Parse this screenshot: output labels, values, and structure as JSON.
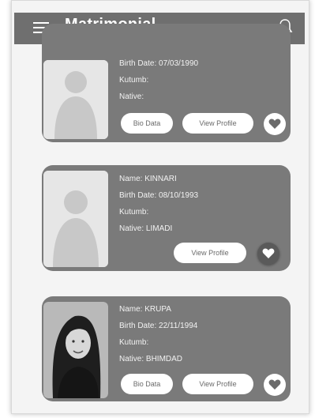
{
  "appbar": {
    "title": "Matrimonial"
  },
  "labels": {
    "name": "Name:",
    "birth_date": "Birth Date:",
    "kutumb": "Kutumb:",
    "native": "Native:"
  },
  "cards": [
    {
      "name": "",
      "birth_date": "07/03/1990",
      "kutumb": "",
      "native": "",
      "bio_data_label": "Bio Data",
      "view_profile_label": "View Profile"
    },
    {
      "name": "KINNARI",
      "birth_date": "08/10/1993",
      "kutumb": "",
      "native": "LIMADI",
      "view_profile_label": "View Profile"
    },
    {
      "name": "KRUPA",
      "birth_date": "22/11/1994",
      "kutumb": "",
      "native": "BHIMDAD",
      "bio_data_label": "Bio Data",
      "view_profile_label": "View Profile"
    }
  ],
  "icons": {
    "menu": "hamburger-menu-icon",
    "notification": "bell-icon",
    "favorite": "heart-icon",
    "avatar": "person-silhouette-icon"
  },
  "colors": {
    "appbar": "#6f6f6f",
    "card": "#7a7a7a",
    "button": "#ffffff"
  }
}
